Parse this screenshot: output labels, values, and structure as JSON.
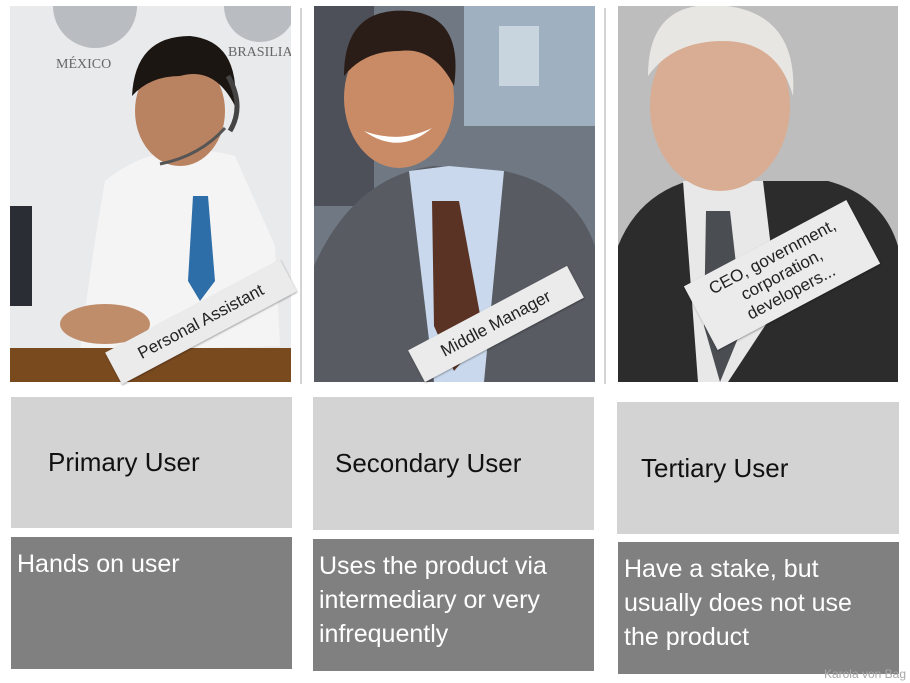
{
  "columns": [
    {
      "photo_labels": [
        "MÉXICO",
        "BRASILIA"
      ],
      "sticker_lines": [
        "Personal Assistant"
      ],
      "role": "Primary User",
      "description": "Hands on user"
    },
    {
      "photo_labels": [],
      "sticker_lines": [
        "Middle Manager"
      ],
      "role": "Secondary User",
      "description": "Uses the product via intermediary or very infrequently"
    },
    {
      "photo_labels": [],
      "sticker_lines": [
        "CEO, government,",
        "corporation,",
        "developers..."
      ],
      "role": "Tertiary User",
      "description": "Have a stake, but usually does not use the product"
    }
  ],
  "credit": "Karola von Bag",
  "colors": {
    "role_box": "#d3d3d3",
    "description_box": "#808080",
    "sticker": "#ebebeb"
  }
}
